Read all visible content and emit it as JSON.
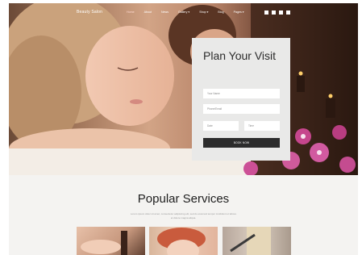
{
  "nav": {
    "logo": "Beauty Salon",
    "links": [
      "Home",
      "About",
      "News",
      "Gallery ▾",
      "Shop ▾",
      "Blog",
      "Pages ▾"
    ]
  },
  "form": {
    "title": "Plan Your Visit",
    "name_placeholder": "Your Name",
    "phone_placeholder": "Phone/Email",
    "date_placeholder": "Date",
    "time_placeholder": "Time",
    "button_label": "BOOK NOW"
  },
  "services": {
    "title": "Popular Services",
    "description": "Lorem ipsum dolor sit amet, consectetur adipiscing elit, sed do eiusmod tempor incididunt ut labore et dolore magna aliqua."
  },
  "colors": {
    "accent": "#2c2c2c",
    "form_bg": "#e9e9e8",
    "page_bg": "#f4f3f1"
  }
}
